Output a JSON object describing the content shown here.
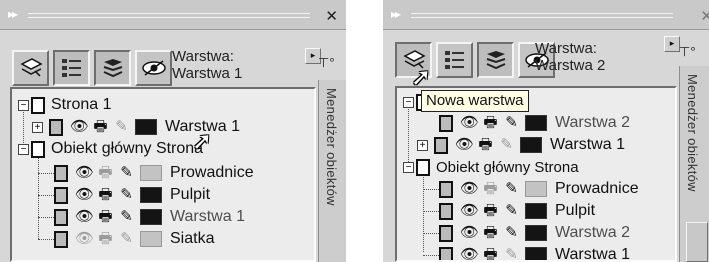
{
  "panels": [
    {
      "layer_label_prefix": "Warstwa:",
      "layer_label_value": "Warstwa 1",
      "side_tab_label": "Menedżer obiektów",
      "toolbar": [
        "new-layer-icon",
        "list-layers-icon",
        "edit-across-layers-icon",
        "layer-manager-view-icon"
      ],
      "tree": {
        "page": "Strona 1",
        "page_layers": [
          {
            "label": "Warstwa 1"
          }
        ],
        "master": "Obiekt główny Strona",
        "master_layers": [
          {
            "label": "Prowadnice"
          },
          {
            "label": "Pulpit"
          },
          {
            "label": "Warstwa 1"
          },
          {
            "label": "Siatka"
          }
        ]
      }
    },
    {
      "layer_label_prefix": "Warstwa:",
      "layer_label_value": "Warstwa 2",
      "side_tab_label": "Menedżer obiektów",
      "tooltip": "Nowa warstwa",
      "toolbar": [
        "new-layer-icon",
        "list-layers-icon",
        "edit-across-layers-icon",
        "layer-manager-view-icon"
      ],
      "tree": {
        "page_layers": [
          {
            "label": "Warstwa 2"
          },
          {
            "label": "Warstwa 1"
          }
        ],
        "master": "Obiekt główny Strona",
        "master_layers": [
          {
            "label": "Prowadnice"
          },
          {
            "label": "Pulpit"
          },
          {
            "label": "Warstwa 2"
          },
          {
            "label": "Warstwa 1"
          }
        ]
      }
    }
  ],
  "glyphs": {
    "close": "✕",
    "grip": "▸▸",
    "arrow": "▸",
    "plus": "+",
    "minus": "−",
    "eye": "👁",
    "printer": "🖶",
    "pencil": "✎",
    "cursor": "➚",
    "side_icon": "⊤°"
  }
}
